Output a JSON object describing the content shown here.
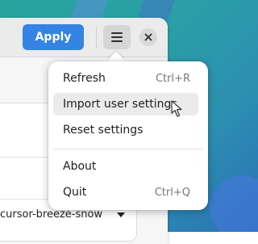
{
  "header": {
    "apply_label": "Apply",
    "menu_icon": "hamburger-icon",
    "close_icon": "close-icon"
  },
  "content": {
    "cursor_theme_value": "cursor-breeze-snow"
  },
  "menu": {
    "items": [
      {
        "label": "Refresh",
        "accel": "Ctrl+R"
      },
      {
        "label": "Import user settings",
        "accel": ""
      },
      {
        "label": "Reset settings",
        "accel": ""
      },
      {
        "label": "About",
        "accel": ""
      },
      {
        "label": "Quit",
        "accel": "Ctrl+Q"
      }
    ]
  },
  "colors": {
    "accent": "#3584e4",
    "hover": "#ebebeb"
  }
}
